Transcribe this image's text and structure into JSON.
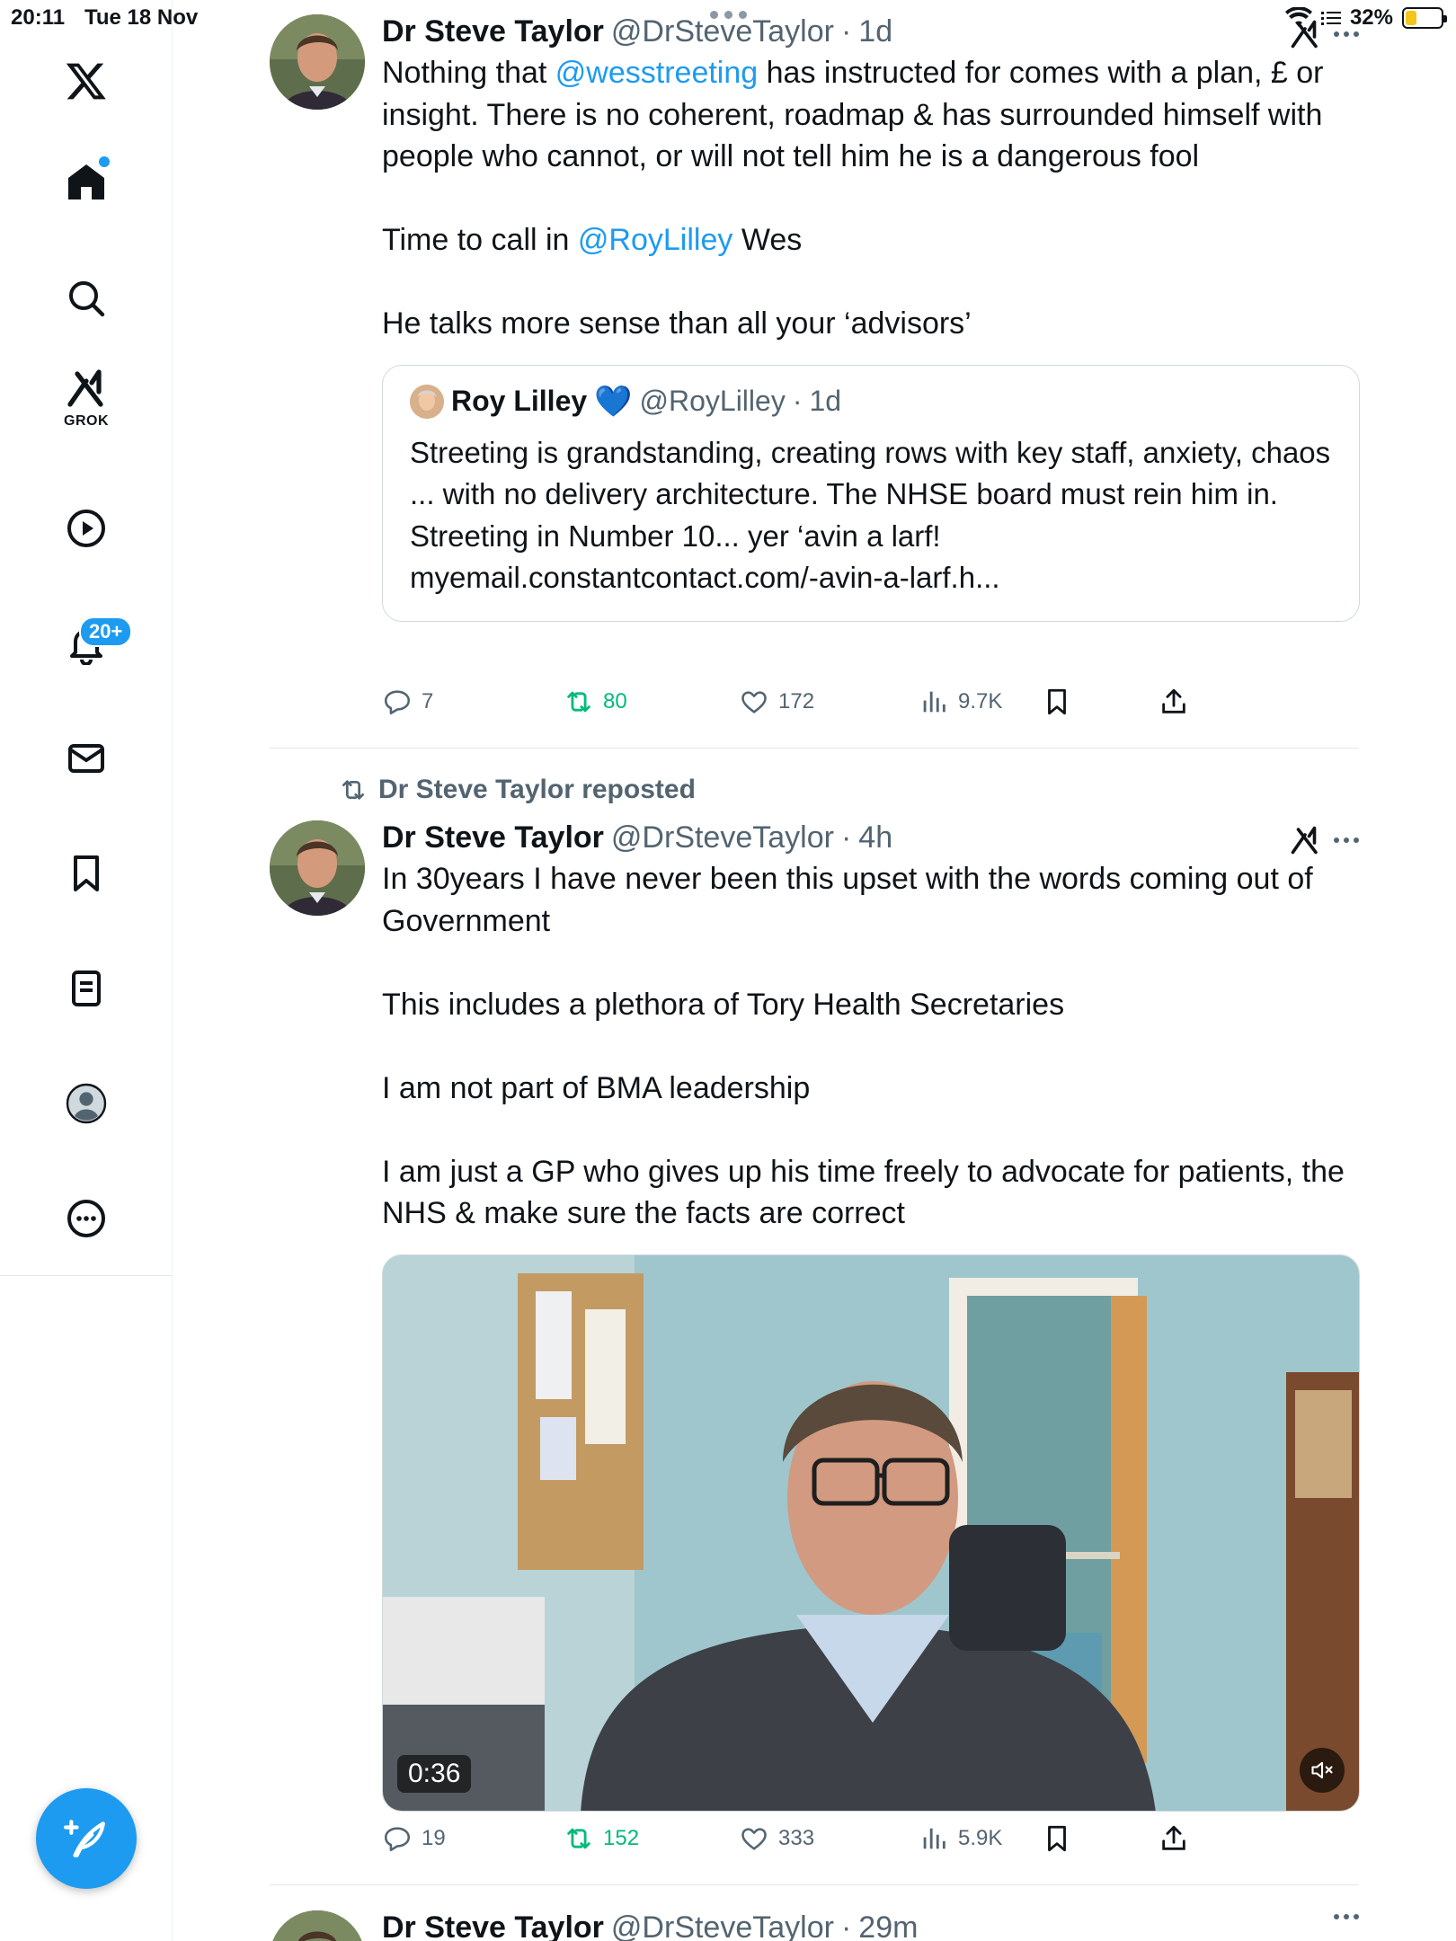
{
  "status_bar": {
    "time": "20:11",
    "date": "Tue 18 Nov",
    "battery": "32%",
    "battery_level": 0.32
  },
  "sidebar": {
    "items": [
      {
        "icon": "x-logo-icon"
      },
      {
        "icon": "home-icon"
      },
      {
        "icon": "search-icon"
      },
      {
        "icon": "grok-icon",
        "label": "GROK"
      },
      {
        "icon": "video-play-icon"
      },
      {
        "icon": "bell-icon",
        "badge": "20+"
      },
      {
        "icon": "mail-icon"
      },
      {
        "icon": "bookmark-icon"
      },
      {
        "icon": "lists-icon"
      },
      {
        "icon": "profile-icon"
      },
      {
        "icon": "more-icon"
      }
    ],
    "compose_icon": "compose-feather-icon"
  },
  "tweets": [
    {
      "name": "Dr Steve Taylor",
      "handle": "@DrSteveTaylor",
      "sep": "·",
      "time": "1d",
      "text": {
        "l1_a": "Nothing that ",
        "l1_mention": "@wesstreeting",
        "l1_b": " has instructed for comes with a plan, £ or insight. There is no coherent, roadmap & has surrounded himself with people who cannot, or will not tell him he is a dangerous fool",
        "l2_a": "Time to call in ",
        "l2_mention": "@RoyLilley",
        "l2_b": " Wes",
        "l3": "He talks more sense than all your ‘advisors’"
      },
      "quote": {
        "name": "Roy Lilley",
        "verified_emoji": "💙",
        "handle": "@RoyLilley",
        "sep": "·",
        "time": "1d",
        "line1": "Streeting is grandstanding, creating rows with key staff, anxiety, chaos ... with no delivery architecture. The NHSE board must rein him in.",
        "line2": "Streeting in Number 10... yer ‘avin a larf!",
        "line3": "myemail.constantcontact.com/-avin-a-larf.h..."
      },
      "stats": {
        "replies": "7",
        "reposts": "80",
        "likes": "172",
        "views": "9.7K"
      }
    },
    {
      "repost_label": "Dr Steve Taylor reposted",
      "name": "Dr Steve Taylor",
      "handle": "@DrSteveTaylor",
      "sep": "·",
      "time": "4h",
      "text": {
        "p1": "In 30years I have never been this upset with the words coming out of Government",
        "p2": "This includes a plethora of Tory Health Secretaries",
        "p3": "I am not part of BMA leadership",
        "p4": "I am just a GP who gives up his time freely to advocate for patients, the NHS & make sure the facts are correct"
      },
      "video": {
        "duration": "0:36",
        "mute_icon": "muted-speaker-icon"
      },
      "stats": {
        "replies": "19",
        "reposts": "152",
        "likes": "333",
        "views": "5.9K"
      }
    },
    {
      "name": "Dr Steve Taylor",
      "handle": "@DrSteveTaylor",
      "sep": "·",
      "time": "29m"
    }
  ],
  "colors": {
    "accent": "#1d9bf0",
    "repost_green": "#00ba7c",
    "muted_text": "#536471",
    "text": "#0f1419"
  }
}
